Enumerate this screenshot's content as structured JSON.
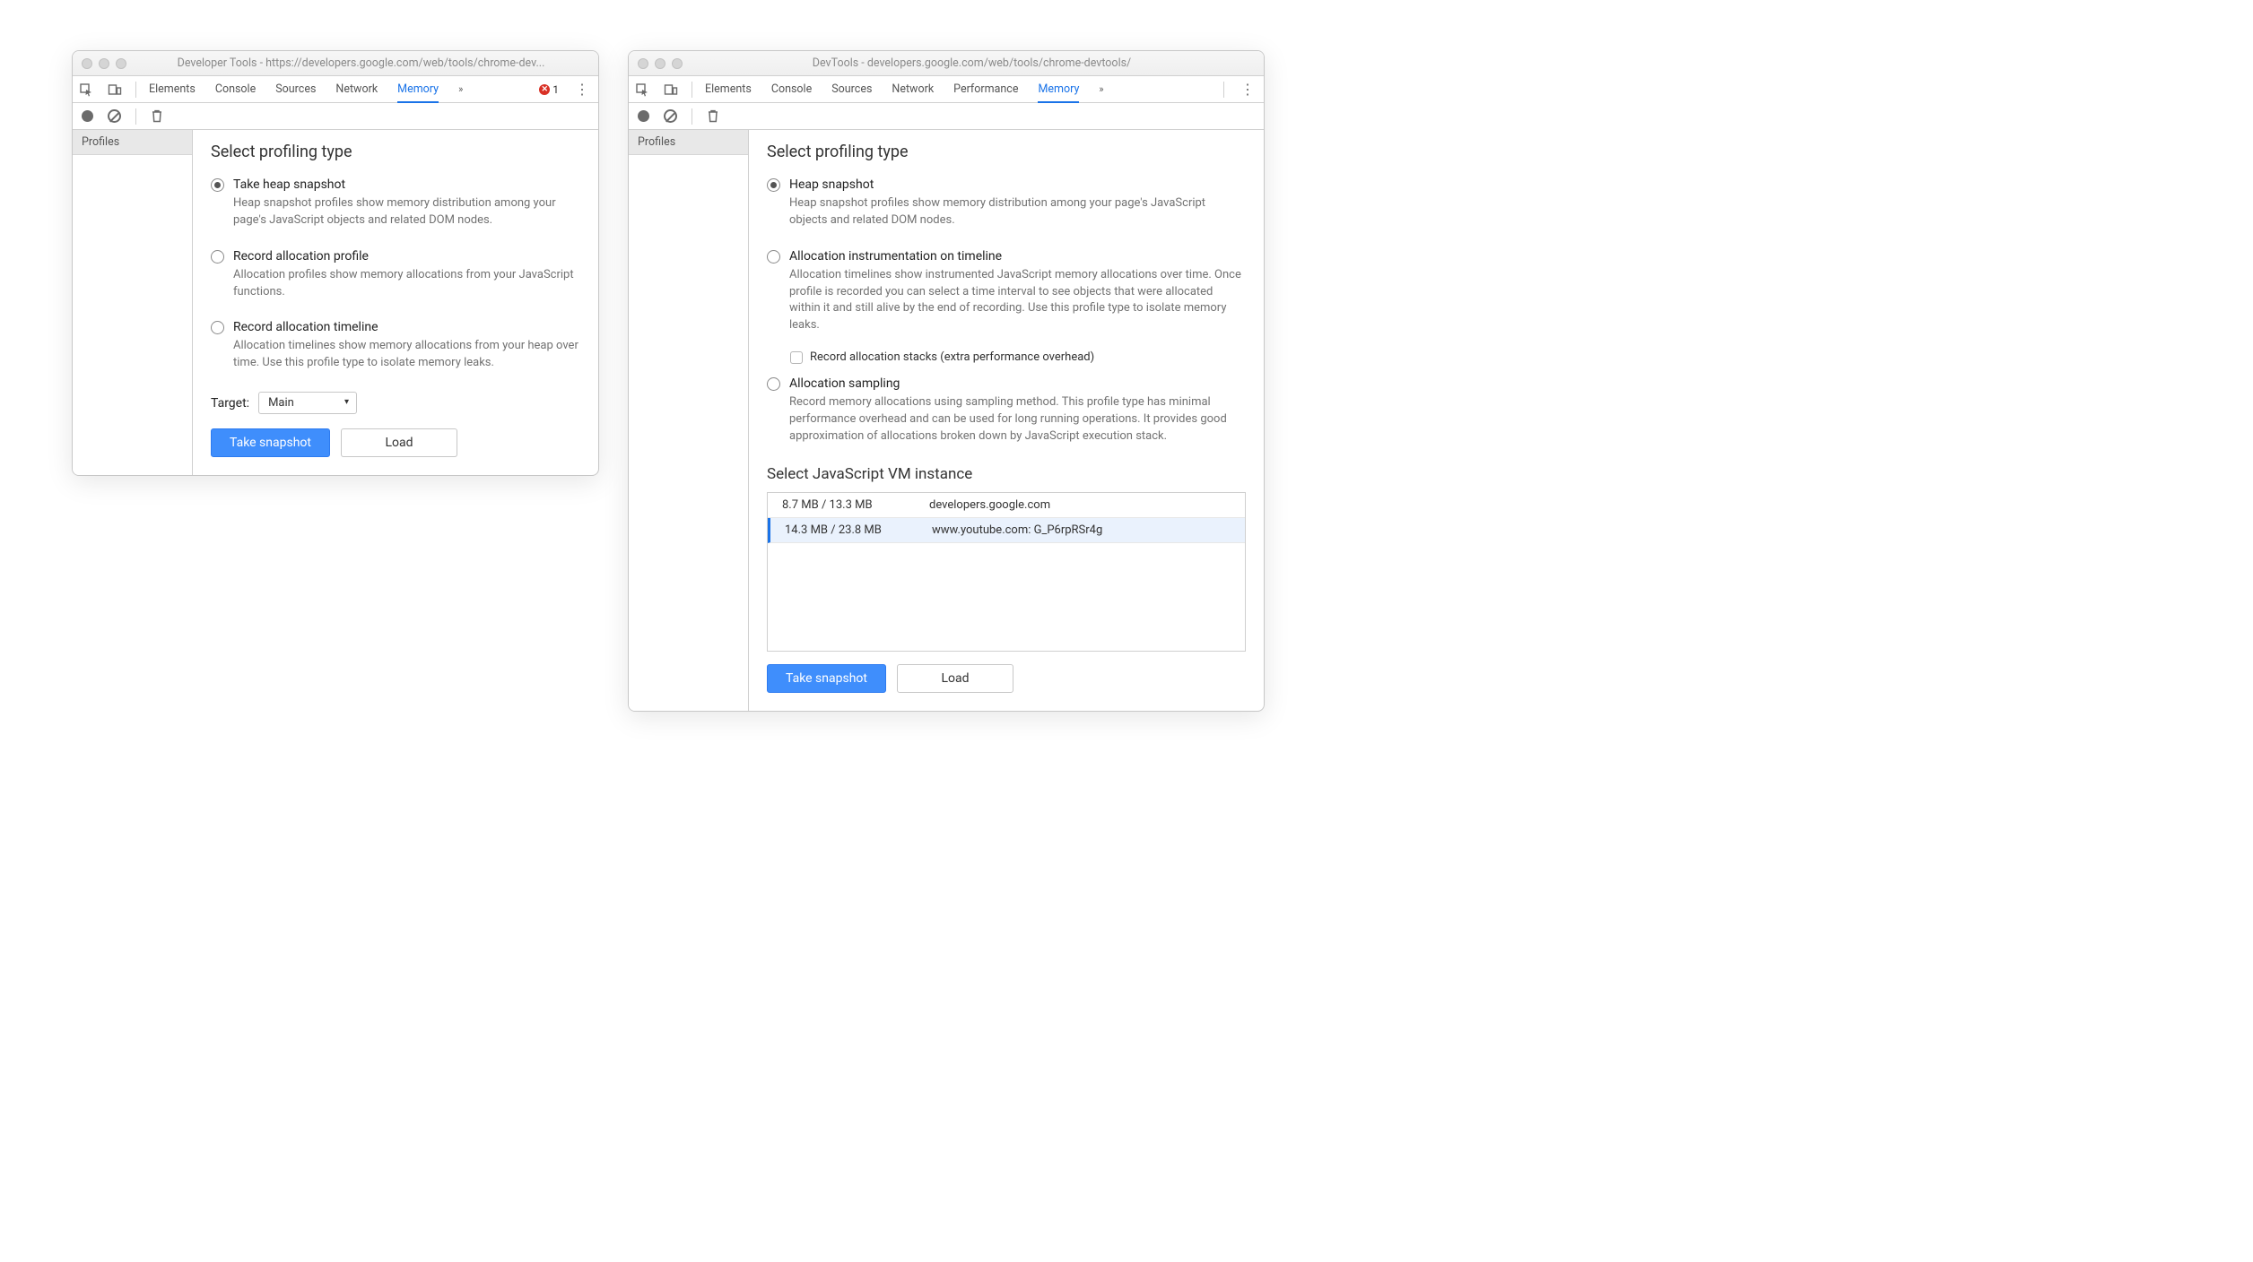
{
  "left": {
    "title": "Developer Tools - https://developers.google.com/web/tools/chrome-dev...",
    "tabs": [
      "Elements",
      "Console",
      "Sources",
      "Network",
      "Memory"
    ],
    "activeTab": "Memory",
    "errorCount": "1",
    "sidebarHeading": "Profiles",
    "heading": "Select profiling type",
    "options": [
      {
        "title": "Take heap snapshot",
        "desc": "Heap snapshot profiles show memory distribution among your page's JavaScript objects and related DOM nodes.",
        "selected": true
      },
      {
        "title": "Record allocation profile",
        "desc": "Allocation profiles show memory allocations from your JavaScript functions.",
        "selected": false
      },
      {
        "title": "Record allocation timeline",
        "desc": "Allocation timelines show memory allocations from your heap over time. Use this profile type to isolate memory leaks.",
        "selected": false
      }
    ],
    "targetLabel": "Target:",
    "targetValue": "Main",
    "primaryBtn": "Take snapshot",
    "secondaryBtn": "Load"
  },
  "right": {
    "title": "DevTools - developers.google.com/web/tools/chrome-devtools/",
    "tabs": [
      "Elements",
      "Console",
      "Sources",
      "Network",
      "Performance",
      "Memory"
    ],
    "activeTab": "Memory",
    "sidebarHeading": "Profiles",
    "heading": "Select profiling type",
    "options": [
      {
        "title": "Heap snapshot",
        "desc": "Heap snapshot profiles show memory distribution among your page's JavaScript objects and related DOM nodes.",
        "selected": true
      },
      {
        "title": "Allocation instrumentation on timeline",
        "desc": "Allocation timelines show instrumented JavaScript memory allocations over time. Once profile is recorded you can select a time interval to see objects that were allocated within it and still alive by the end of recording. Use this profile type to isolate memory leaks.",
        "selected": false,
        "sub": "Record allocation stacks (extra performance overhead)"
      },
      {
        "title": "Allocation sampling",
        "desc": "Record memory allocations using sampling method. This profile type has minimal performance overhead and can be used for long running operations. It provides good approximation of allocations broken down by JavaScript execution stack.",
        "selected": false
      }
    ],
    "vmHeading": "Select JavaScript VM instance",
    "vmRows": [
      {
        "mem": "8.7 MB / 13.3 MB",
        "name": "developers.google.com",
        "selected": false
      },
      {
        "mem": "14.3 MB / 23.8 MB",
        "name": "www.youtube.com: G_P6rpRSr4g",
        "selected": true
      }
    ],
    "primaryBtn": "Take snapshot",
    "secondaryBtn": "Load"
  }
}
